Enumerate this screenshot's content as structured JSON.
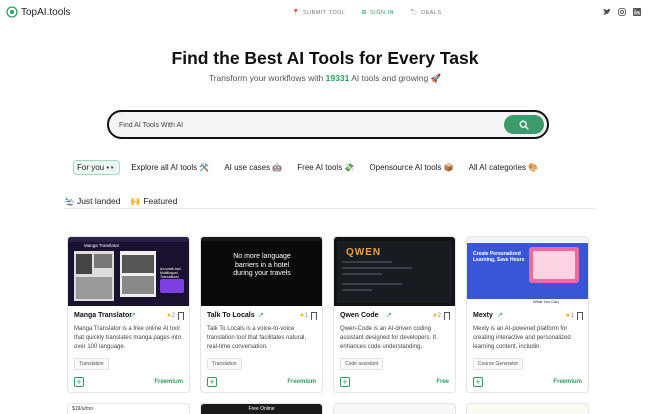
{
  "brand": {
    "name": "TopAI.tools"
  },
  "nav": {
    "submit": "SUBMIT TOOL",
    "signin": "SIGN IN",
    "deals": "DEALS"
  },
  "hero": {
    "title": "Find the Best AI Tools for Every Task",
    "sub_before": "Transform your workflows with ",
    "count": "19331",
    "sub_after": " AI tools and growing 🚀"
  },
  "search": {
    "placeholder": "Find AI Tools With AI"
  },
  "categories": [
    "For you 👀",
    "Explore all AI tools 🛠️",
    "AI use cases 🤖",
    "Free AI tools 💸",
    "Opensource AI tools 📦",
    "All AI categories 🎨"
  ],
  "subtabs": [
    "🛬 Just landed",
    "🙌 Featured"
  ],
  "colors": {
    "accent": "#2e9e5b",
    "search_button": "#3d9a6a"
  },
  "cards": [
    {
      "name": "Manga Translator",
      "rating": "2",
      "description": "Manga Translator is a free online AI tool that quickly translates manga pages into over 100 language.",
      "tag": "Translation",
      "price": "Freemium",
      "thumb_title": "Manga Translator",
      "thumb_sub": "Accurate and Multilingual Translations"
    },
    {
      "name": "Talk To Locals",
      "rating": "1",
      "description": "Talk To Locals is a voice-to-voice translation tool that facilitates natural, real-time conversation.",
      "tag": "Translation",
      "price": "Freemium",
      "thumb_title": "No more language barriers in a hotel during your travels"
    },
    {
      "name": "Qwen Code",
      "rating": "2",
      "description": "Qwen-Code is an AI-driven coding assistant designed for developers. It enhances code understanding,",
      "tag": "Code assistant",
      "price": "Free",
      "thumb_title": "QWEN"
    },
    {
      "name": "Mexty",
      "rating": "1",
      "description": "Mexty is an AI-powered platform for creating interactive and personalized learning content, includin.",
      "tag": "Course Generator",
      "price": "Freemium",
      "thumb_title": "Create Personalized Learning, Save Hours",
      "thumb_sub": "What You Can"
    }
  ],
  "peek": [
    "$19/u/mo",
    "Free Online",
    "",
    ""
  ]
}
